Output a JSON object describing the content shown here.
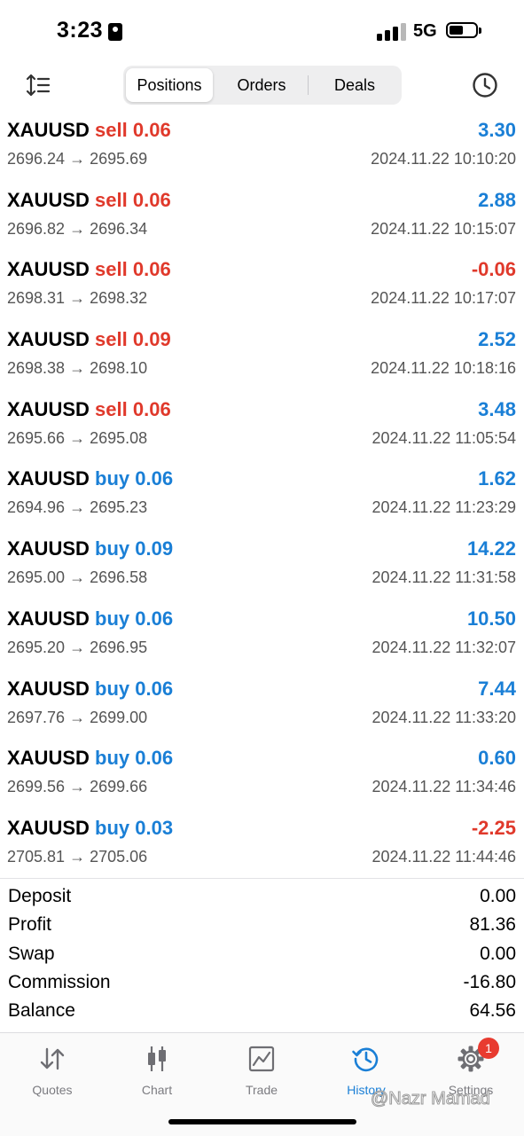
{
  "status_bar": {
    "time": "3:23",
    "network": "5G",
    "battery_level": 0.55
  },
  "tabs": [
    {
      "label": "Positions",
      "active": true
    },
    {
      "label": "Orders",
      "active": false
    },
    {
      "label": "Deals",
      "active": false
    }
  ],
  "deals": [
    {
      "symbol": "XAUUSD",
      "side": "sell",
      "volume": "0.06",
      "prices": "2696.24 → 2695.69",
      "datetime": "2024.11.22 10:10:20",
      "profit": "3.30"
    },
    {
      "symbol": "XAUUSD",
      "side": "sell",
      "volume": "0.06",
      "prices": "2696.82 → 2696.34",
      "datetime": "2024.11.22 10:15:07",
      "profit": "2.88"
    },
    {
      "symbol": "XAUUSD",
      "side": "sell",
      "volume": "0.06",
      "prices": "2698.31 → 2698.32",
      "datetime": "2024.11.22 10:17:07",
      "profit": "-0.06"
    },
    {
      "symbol": "XAUUSD",
      "side": "sell",
      "volume": "0.09",
      "prices": "2698.38 → 2698.10",
      "datetime": "2024.11.22 10:18:16",
      "profit": "2.52"
    },
    {
      "symbol": "XAUUSD",
      "side": "sell",
      "volume": "0.06",
      "prices": "2695.66 → 2695.08",
      "datetime": "2024.11.22 11:05:54",
      "profit": "3.48"
    },
    {
      "symbol": "XAUUSD",
      "side": "buy",
      "volume": "0.06",
      "prices": "2694.96 → 2695.23",
      "datetime": "2024.11.22 11:23:29",
      "profit": "1.62"
    },
    {
      "symbol": "XAUUSD",
      "side": "buy",
      "volume": "0.09",
      "prices": "2695.00 → 2696.58",
      "datetime": "2024.11.22 11:31:58",
      "profit": "14.22"
    },
    {
      "symbol": "XAUUSD",
      "side": "buy",
      "volume": "0.06",
      "prices": "2695.20 → 2696.95",
      "datetime": "2024.11.22 11:32:07",
      "profit": "10.50"
    },
    {
      "symbol": "XAUUSD",
      "side": "buy",
      "volume": "0.06",
      "prices": "2697.76 → 2699.00",
      "datetime": "2024.11.22 11:33:20",
      "profit": "7.44"
    },
    {
      "symbol": "XAUUSD",
      "side": "buy",
      "volume": "0.06",
      "prices": "2699.56 → 2699.66",
      "datetime": "2024.11.22 11:34:46",
      "profit": "0.60"
    },
    {
      "symbol": "XAUUSD",
      "side": "buy",
      "volume": "0.03",
      "prices": "2705.81 → 2705.06",
      "datetime": "2024.11.22 11:44:46",
      "profit": "-2.25"
    }
  ],
  "summary": [
    {
      "label": "Deposit",
      "value": "0.00"
    },
    {
      "label": "Profit",
      "value": "81.36"
    },
    {
      "label": "Swap",
      "value": "0.00"
    },
    {
      "label": "Commission",
      "value": "-16.80"
    },
    {
      "label": "Balance",
      "value": "64.56"
    }
  ],
  "colors": {
    "sell": "#e0392b",
    "buy": "#1a7fd6",
    "loss": "#e0392b",
    "accent": "#1a7fd6"
  },
  "bottom_nav": [
    {
      "label": "Quotes",
      "icon": "quotes-arrows-icon"
    },
    {
      "label": "Chart",
      "icon": "candlestick-icon"
    },
    {
      "label": "Trade",
      "icon": "trade-chart-icon"
    },
    {
      "label": "History",
      "icon": "history-icon",
      "active": true
    },
    {
      "label": "Settings",
      "icon": "gear-icon",
      "badge": "1"
    }
  ],
  "watermark": "@Nazr Mamad"
}
